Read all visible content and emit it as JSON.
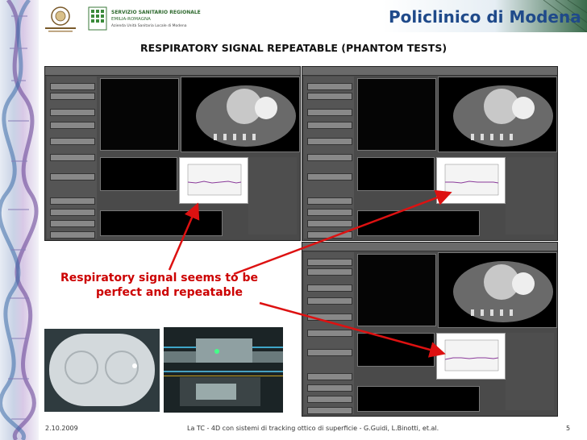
{
  "header": {
    "university_logo_text": "UNIVERSITÀ DEGLI STUDI DI MODENA E REGGIO EMILIA",
    "ssr_logo_line1": "SERVIZIO SANITARIO REGIONALE",
    "ssr_logo_line2": "EMILIA-ROMAGNA",
    "ssr_logo_line3": "Azienda Unità Sanitaria Locale di Modena",
    "brand": "Policlinico di Modena",
    "brand_color": "#1f4a8a"
  },
  "slide": {
    "title": "RESPIRATORY SIGNAL REPEATABLE (PHANTOM TESTS)",
    "annotation_line1": "Respiratory signal seems to be",
    "annotation_line2": "perfect and repeatable",
    "annotation_color": "#cc0000"
  },
  "footer": {
    "date": "2.10.2009",
    "citation": "La TC - 4D con sistemi di tracking ottico di superficie - G.Guidi, L.Binotti, et.al.",
    "page": "5"
  },
  "icons": [
    "dna-helix-icon",
    "university-seal-icon",
    "ssr-emblem-icon",
    "arrow-icon"
  ]
}
